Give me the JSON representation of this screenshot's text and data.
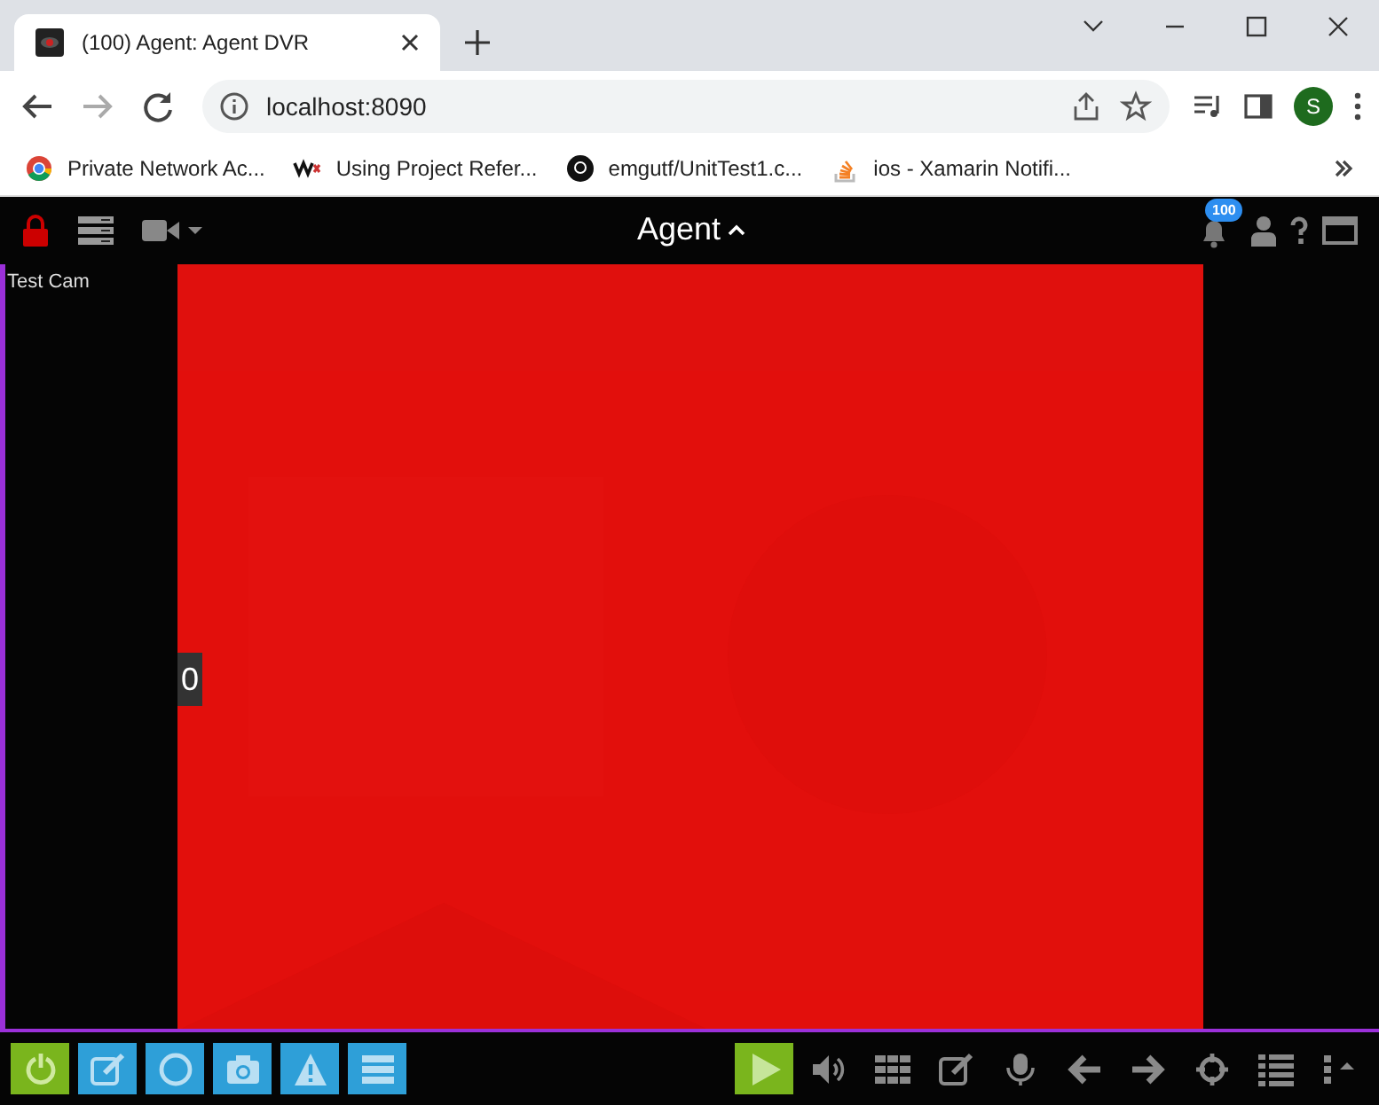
{
  "browser": {
    "tab": {
      "title": "(100) Agent: Agent DVR"
    },
    "address": "localhost:8090",
    "profile_initial": "S",
    "bookmarks": [
      {
        "label": "Private Network Ac...",
        "kind": "chrome"
      },
      {
        "label": "Using Project Refer...",
        "kind": "wix"
      },
      {
        "label": "emgutf/UnitTest1.c...",
        "kind": "github"
      },
      {
        "label": "ios - Xamarin Notifi...",
        "kind": "stack"
      }
    ]
  },
  "app": {
    "title": "Agent",
    "notification_count": "100",
    "camera": {
      "name": "Test Cam",
      "badge": "0"
    },
    "left_buttons": [
      {
        "kind": "power"
      },
      {
        "kind": "edit"
      },
      {
        "kind": "record"
      },
      {
        "kind": "snapshot"
      },
      {
        "kind": "alert"
      },
      {
        "kind": "storage"
      }
    ],
    "right_buttons": [
      {
        "kind": "play"
      },
      {
        "kind": "volume"
      },
      {
        "kind": "grid"
      },
      {
        "kind": "edit"
      },
      {
        "kind": "mic"
      },
      {
        "kind": "back"
      },
      {
        "kind": "forward"
      },
      {
        "kind": "ptz"
      },
      {
        "kind": "list"
      },
      {
        "kind": "more"
      }
    ]
  }
}
